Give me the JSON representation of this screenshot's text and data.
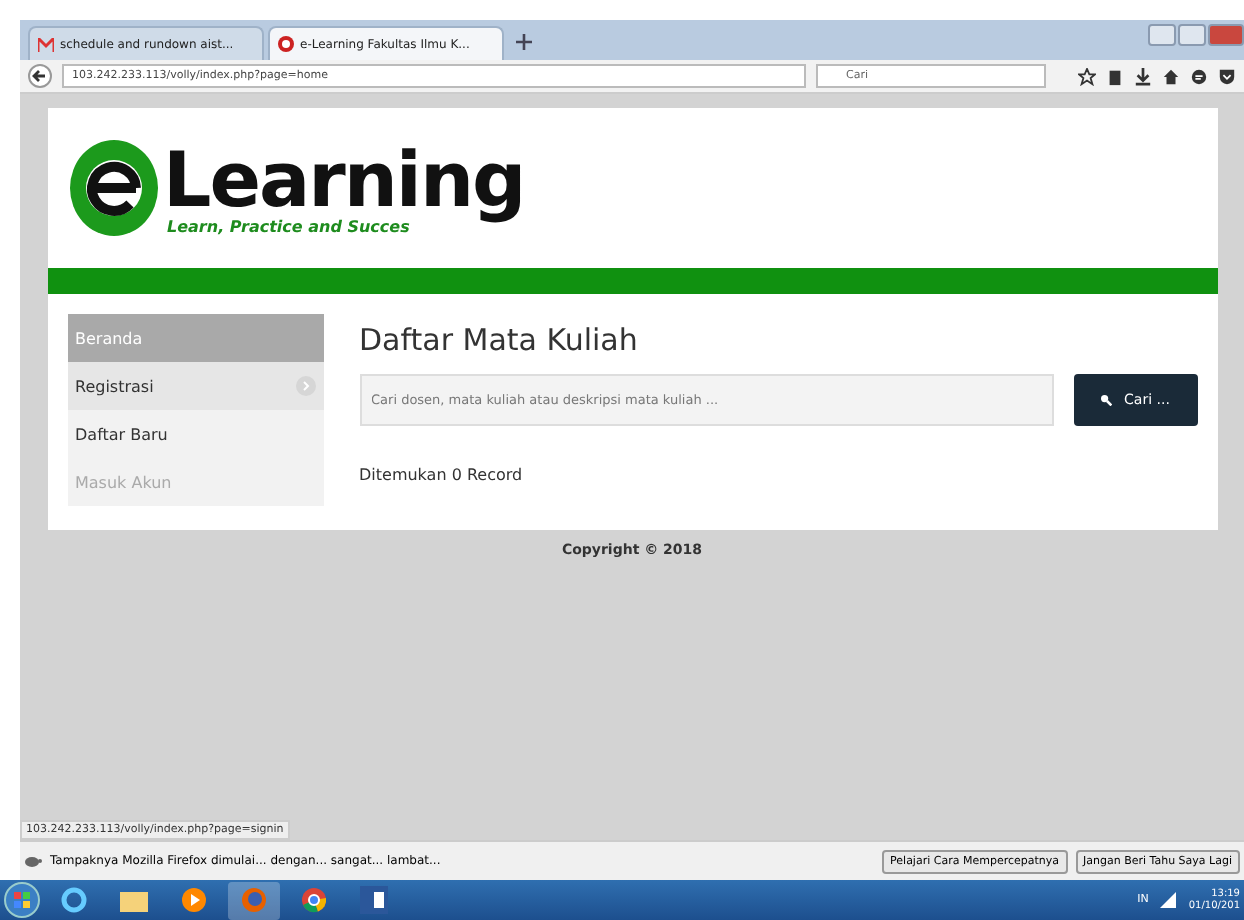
{
  "browser": {
    "tabs": [
      {
        "title": "schedule and rundown aist...",
        "selected": false
      },
      {
        "title": "e-Learning Fakultas Ilmu K...",
        "selected": true
      }
    ],
    "address": "103.242.233.113/volly/index.php?page=home",
    "search": {
      "placeholder": "Cari"
    }
  },
  "header": {
    "logo_word": "Learning",
    "tagline": "Learn, Practice and Succes"
  },
  "sidebar": {
    "items": [
      {
        "label": "Beranda",
        "selected": true,
        "expanded": false,
        "disabled": false
      },
      {
        "label": "Registrasi",
        "selected": false,
        "expanded": true,
        "disabled": false,
        "children": [
          {
            "label": "Daftar Baru",
            "selected": false,
            "disabled": false
          },
          {
            "label": "Masuk Akun",
            "selected": false,
            "disabled": true
          }
        ]
      }
    ]
  },
  "main": {
    "title": "Daftar Mata Kuliah",
    "search": {
      "placeholder": "Cari dosen, mata kuliah atau deskripsi mata kuliah ..."
    },
    "search_button": "Cari ...",
    "result": "Ditemukan 0 Record"
  },
  "footer": "Copyright © 2018",
  "status_url": "103.242.233.113/volly/index.php?page=signin",
  "notification": {
    "message": "Tampaknya Mozilla Firefox dimulai... dengan... sangat... lambat...",
    "buttons": [
      "Pelajari Cara Mempercepatnya",
      "Jangan Beri Tahu Saya Lagi"
    ]
  },
  "taskbar": {
    "lang": "IN",
    "time": "13:19",
    "date": "01/10/201"
  }
}
